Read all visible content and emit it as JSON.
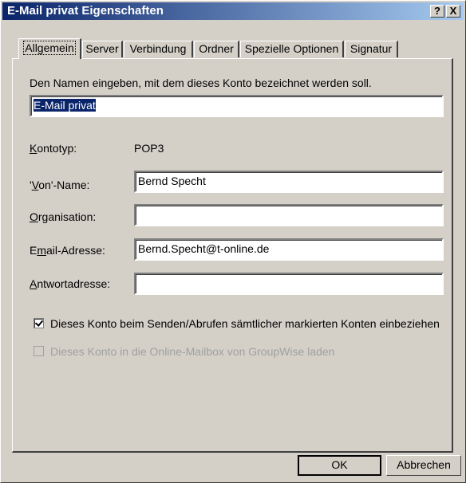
{
  "window": {
    "title": "E-Mail privat Eigenschaften",
    "help_label": "?",
    "close_label": "X"
  },
  "tabs": [
    {
      "label": "Allgemein",
      "active": true
    },
    {
      "label": "Server",
      "active": false
    },
    {
      "label": "Verbindung",
      "active": false
    },
    {
      "label": "Ordner",
      "active": false
    },
    {
      "label": "Spezielle Optionen",
      "active": false
    },
    {
      "label": "Signatur",
      "active": false
    }
  ],
  "general": {
    "instruction": "Den Namen eingeben, mit dem dieses Konto bezeichnet werden soll.",
    "account_name": "E-Mail privat",
    "account_type_label": "Kontotyp:",
    "account_type_value": "POP3",
    "from_name_label": "'Von'-Name:",
    "from_name_value": "Bernd Specht",
    "organization_label": "Organisation:",
    "organization_value": "",
    "email_label": "Email-Adresse:",
    "email_value": "Bernd.Specht@t-online.de",
    "reply_label": "Antwortadresse:",
    "reply_value": "",
    "include_label": "Dieses Konto beim Senden/Abrufen sämtlicher markierten Konten einbeziehen",
    "include_checked": true,
    "groupwise_label": "Dieses Konto in die Online-Mailbox von GroupWise laden",
    "groupwise_checked": false
  },
  "buttons": {
    "ok": "OK",
    "cancel": "Abbrechen"
  }
}
